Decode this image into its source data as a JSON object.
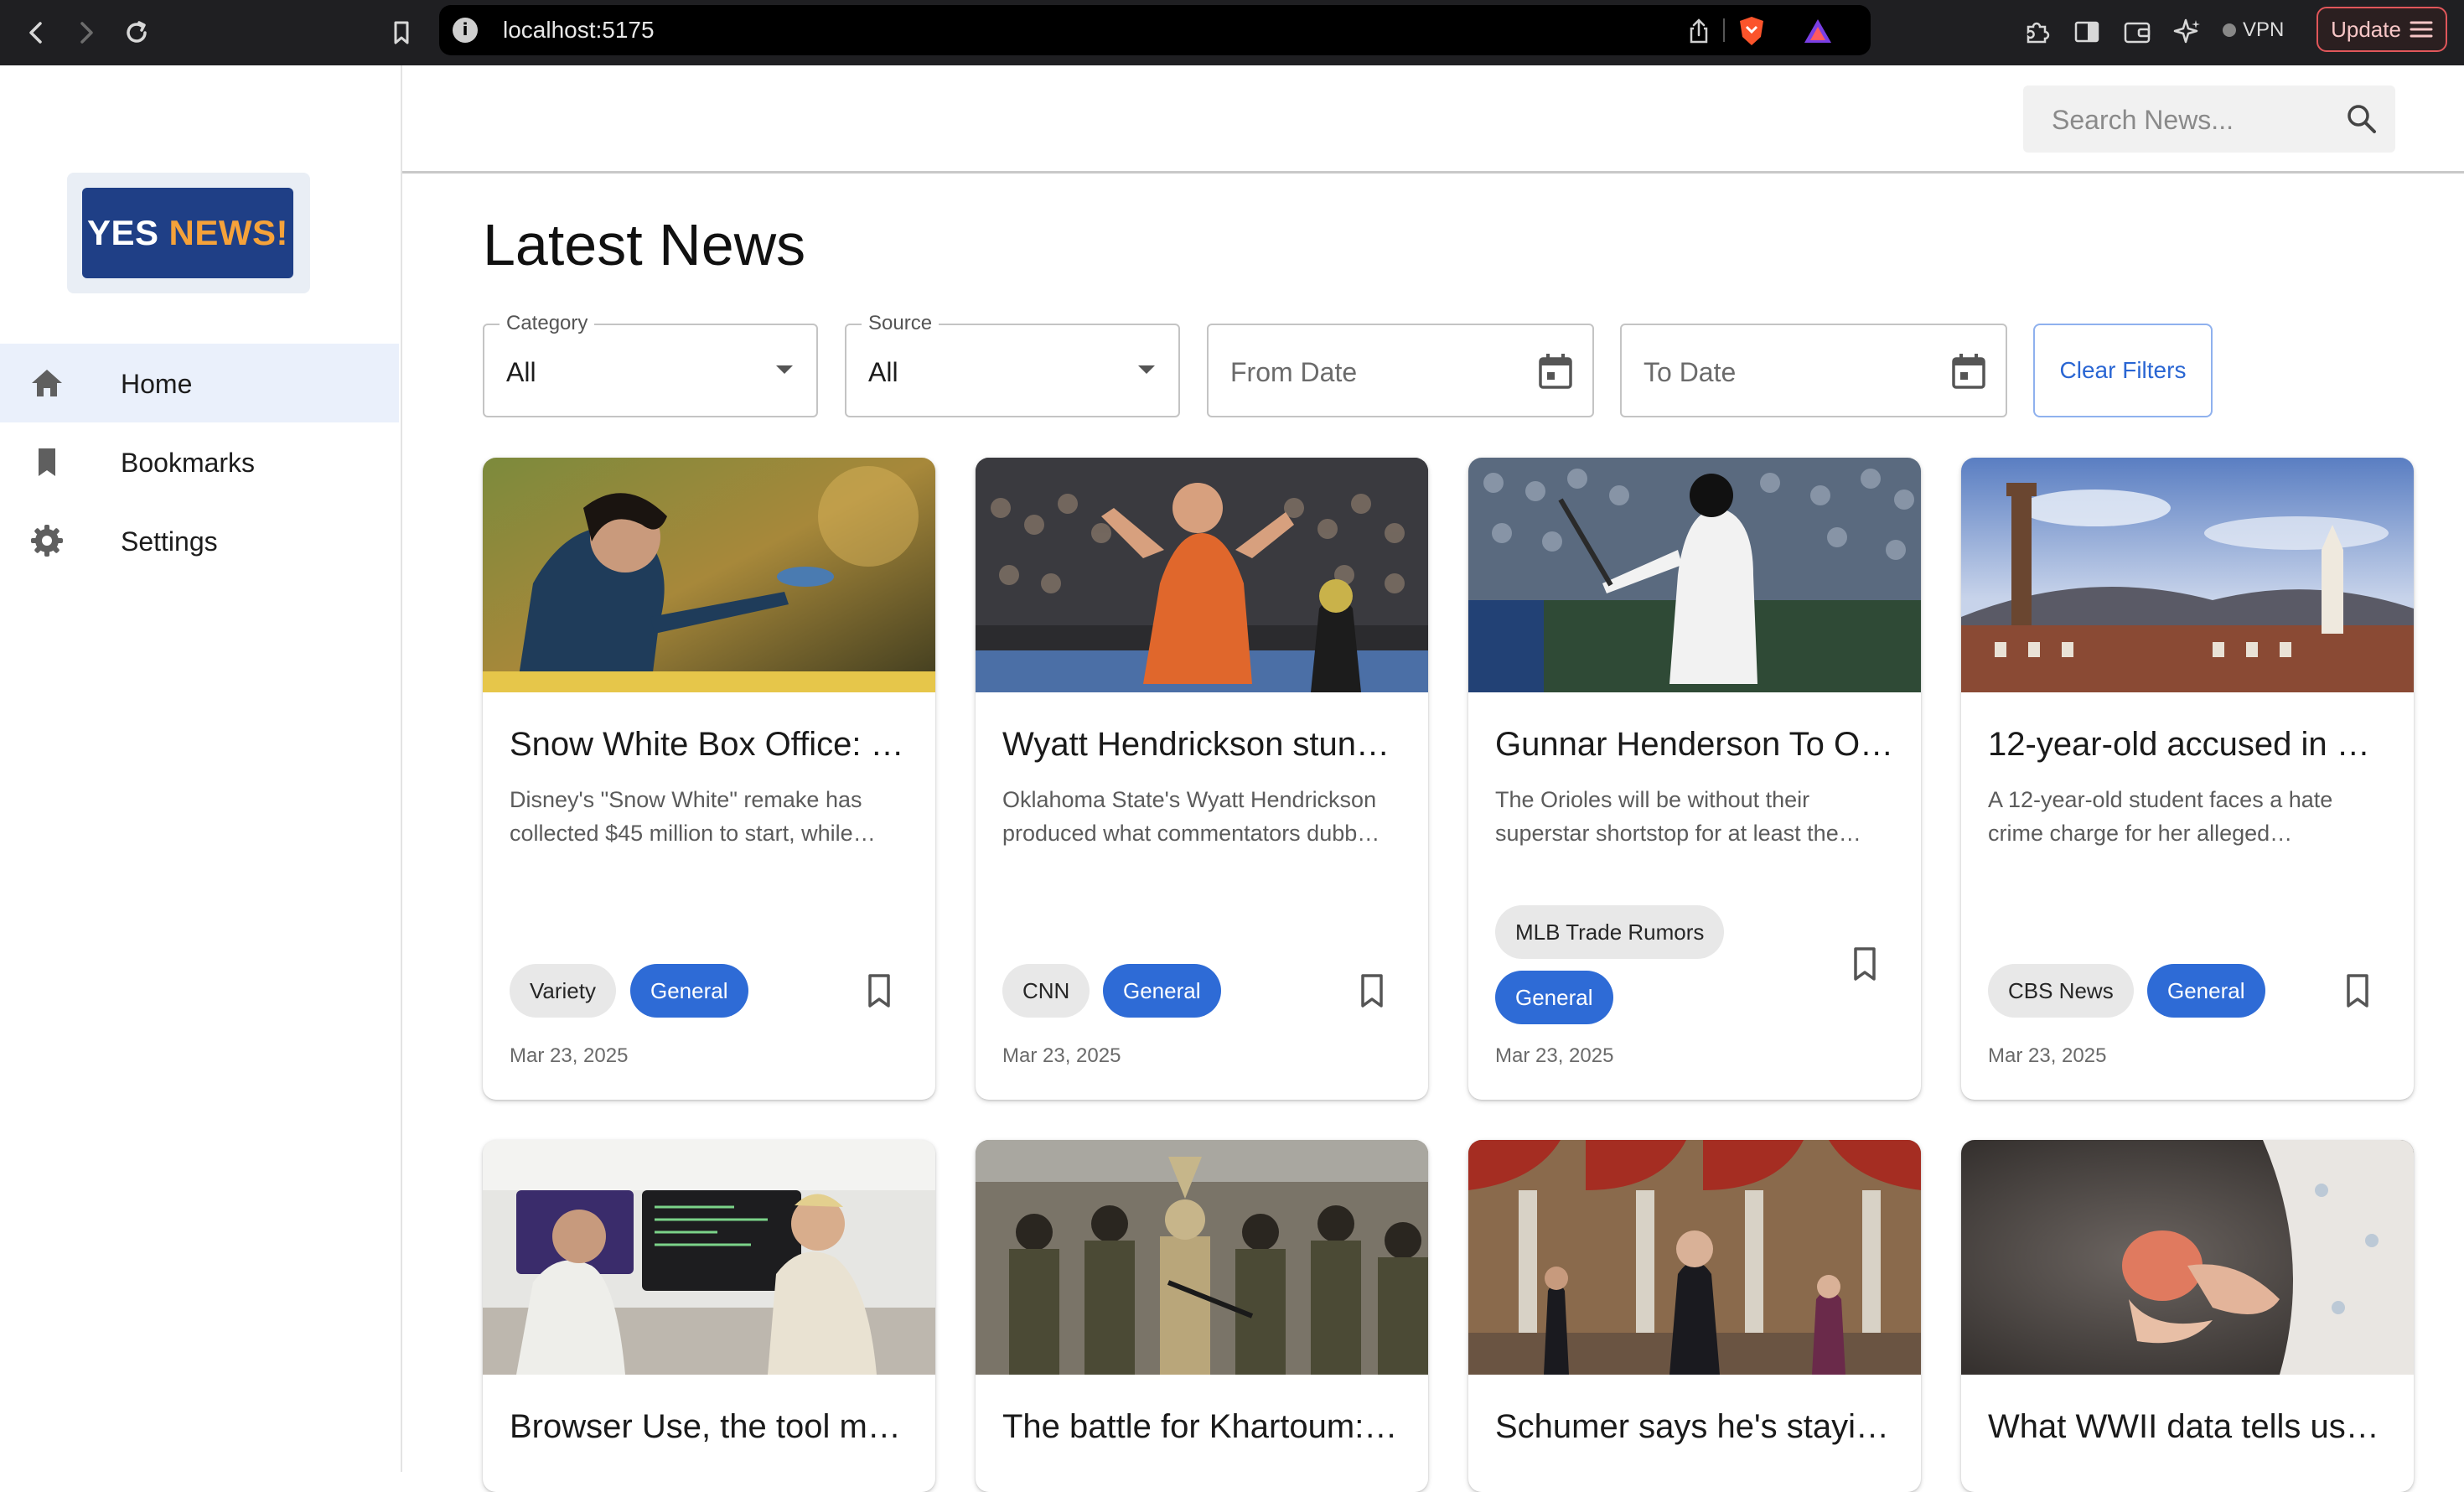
{
  "browser": {
    "url": "localhost:5175",
    "vpn_label": "VPN",
    "update_label": "Update"
  },
  "logo": {
    "word1": "YES",
    "word2": "NEWS!"
  },
  "sidebar": {
    "items": [
      {
        "label": "Home",
        "icon": "home-icon",
        "active": true
      },
      {
        "label": "Bookmarks",
        "icon": "bookmark-icon",
        "active": false
      },
      {
        "label": "Settings",
        "icon": "gear-icon",
        "active": false
      }
    ]
  },
  "search": {
    "placeholder": "Search News..."
  },
  "page": {
    "title": "Latest News"
  },
  "filters": {
    "category": {
      "label": "Category",
      "value": "All"
    },
    "source": {
      "label": "Source",
      "value": "All"
    },
    "from_date": {
      "placeholder": "From Date"
    },
    "to_date": {
      "placeholder": "To Date"
    },
    "clear_label": "Clear Filters"
  },
  "colors": {
    "accent": "#2e6bd6",
    "logo_bg": "#1f3f86",
    "logo_accent": "#f5a23a",
    "active_nav": "#eaf0fb"
  },
  "articles": [
    {
      "title": "Snow White Box Office: …",
      "description": "Disney's \"Snow White\" remake has collected $45 million to start, while…",
      "source": "Variety",
      "category": "General",
      "date": "Mar 23, 2025"
    },
    {
      "title": "Wyatt Hendrickson stun…",
      "description": "Oklahoma State's Wyatt Hendrickson produced what commentators dubb…",
      "source": "CNN",
      "category": "General",
      "date": "Mar 23, 2025"
    },
    {
      "title": "Gunnar Henderson To O…",
      "description": "The Orioles will be without their superstar shortstop for at least the…",
      "source": "MLB Trade Rumors",
      "category": "General",
      "date": "Mar 23, 2025"
    },
    {
      "title": "12-year-old accused in …",
      "description": "A 12-year-old student faces a hate crime charge for her alleged…",
      "source": "CBS News",
      "category": "General",
      "date": "Mar 23, 2025"
    },
    {
      "title": "Browser Use, the tool m…"
    },
    {
      "title": "The battle for Khartoum:…"
    },
    {
      "title": "Schumer says he's stayi…"
    },
    {
      "title": "What WWII data tells us…"
    }
  ]
}
